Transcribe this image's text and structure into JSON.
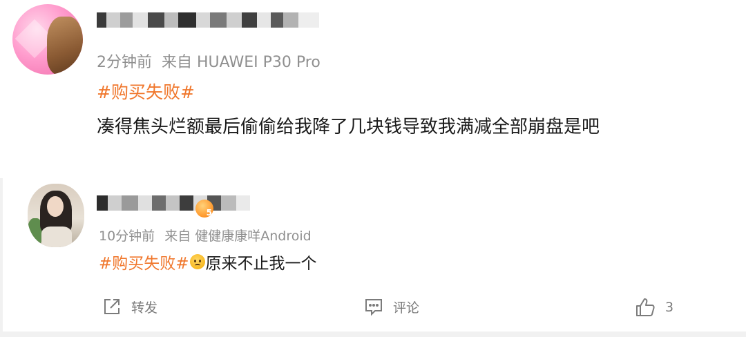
{
  "post": {
    "author_name_redacted": true,
    "meta": {
      "time": "2分钟前",
      "source": "来自 HUAWEI P30 Pro"
    },
    "topic": "#购买失败#",
    "text": "凑得焦头烂额最后偷偷给我降了几块钱导致我满减全部崩盘是吧"
  },
  "reply": {
    "author_name_redacted": true,
    "vip_level": "5",
    "meta": {
      "time": "10分钟前",
      "source": "来自 健健康康咩Android"
    },
    "topic": "#购买失败#",
    "emoji": "frowning-face",
    "text": "原来不止我一个"
  },
  "actions": {
    "share_label": "转发",
    "comment_label": "评论",
    "like_count": "3"
  },
  "colors": {
    "topic": "#f0772c",
    "meta": "#8f8f8f",
    "body": "#1a1a1a",
    "action": "#7b7b7b"
  }
}
